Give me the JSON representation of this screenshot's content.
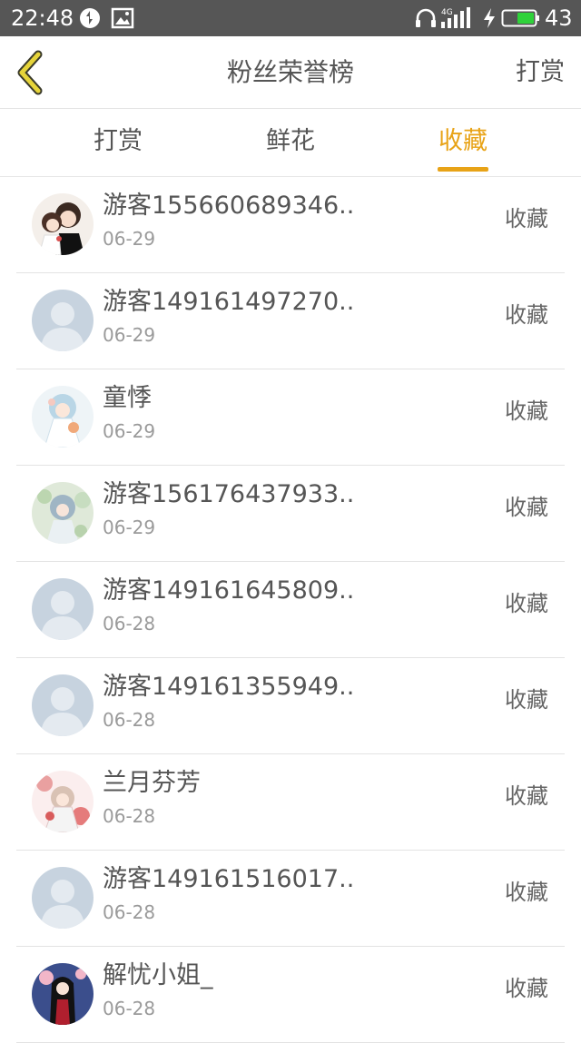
{
  "status_bar": {
    "time": "22:48",
    "network": "4G",
    "battery_level": "43",
    "icons": [
      "sync-icon",
      "image-icon",
      "headphone-icon",
      "signal-icon",
      "charging-icon",
      "battery-icon"
    ]
  },
  "header": {
    "title": "粉丝荣誉榜",
    "right_action": "打赏",
    "back_icon": "chevron-left-icon"
  },
  "tabs": [
    {
      "label": "打赏",
      "active": false
    },
    {
      "label": "鲜花",
      "active": false
    },
    {
      "label": "收藏",
      "active": true
    }
  ],
  "colors": {
    "accent": "#e8a317",
    "status_bar": "#565656",
    "text": "#555555",
    "subtext": "#9a9a9a",
    "default_avatar_bg": "#c7d3df"
  },
  "rows": [
    {
      "name": "游客155660689346..",
      "date": "06-29",
      "action": "收藏",
      "avatar": "couple-illustration"
    },
    {
      "name": "游客149161497270..",
      "date": "06-29",
      "action": "收藏",
      "avatar": "default-user"
    },
    {
      "name": "童悸",
      "date": "06-29",
      "action": "收藏",
      "avatar": "bride-illustration"
    },
    {
      "name": "游客156176437933..",
      "date": "06-29",
      "action": "收藏",
      "avatar": "floral-girl-illustration"
    },
    {
      "name": "游客149161645809..",
      "date": "06-28",
      "action": "收藏",
      "avatar": "default-user"
    },
    {
      "name": "游客149161355949..",
      "date": "06-28",
      "action": "收藏",
      "avatar": "default-user"
    },
    {
      "name": "兰月芬芳",
      "date": "06-28",
      "action": "收藏",
      "avatar": "red-blossom-illustration"
    },
    {
      "name": "游客149161516017..",
      "date": "06-28",
      "action": "收藏",
      "avatar": "default-user"
    },
    {
      "name": "解忧小姐_",
      "date": "06-28",
      "action": "收藏",
      "avatar": "dark-haired-girl-illustration"
    }
  ]
}
